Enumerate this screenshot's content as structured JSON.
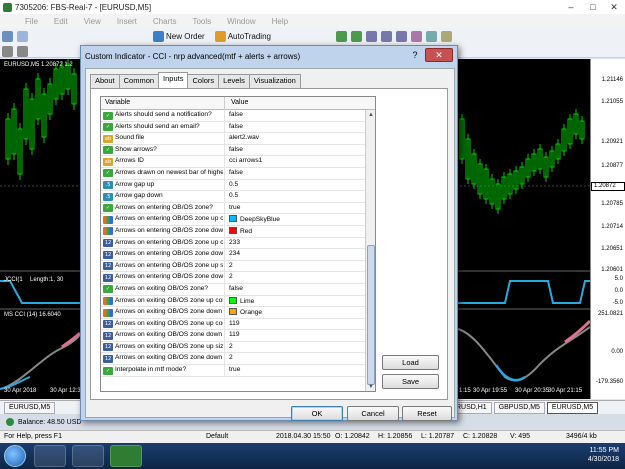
{
  "window": {
    "title": "7305206: FBS-Real-7 - [EURUSD,M5]",
    "minimize": "–",
    "maximize": "□",
    "close": "✕"
  },
  "menu": [
    "File",
    "Edit",
    "View",
    "Insert",
    "Charts",
    "Tools",
    "Window",
    "Help"
  ],
  "toolbar": {
    "new_order": "New Order",
    "autotrading": "AutoTrading"
  },
  "chart": {
    "symbol_label": "EURUSD,M5  1.20872 1.2",
    "cci_label": "JCCI(1",
    "cci_label_rest": "Length:1, 30",
    "mscci_label": "MS CCI (14) 16.6040",
    "price_labels": [
      "1.21146",
      "1.21055",
      "1.20921",
      "1.20877",
      "1.20785",
      "1.20714",
      "1.20651",
      "1.20601",
      "1.20544"
    ],
    "current_price": "1.20872",
    "cci_levels": [
      "5.0",
      "0.0",
      "-5.0"
    ],
    "mscci_levels": [
      "251.0821",
      "0.00",
      "-179.3560"
    ],
    "time_labels_left": [
      "30 Apr 2018",
      "30 Apr 12:35"
    ],
    "time_labels_right": [
      "1:15",
      "30 Apr 19:55",
      "30 Apr 20:35",
      "30 Apr 21:15",
      "30 Apr 21:55"
    ]
  },
  "chart_tabs": [
    "EURUSD,M5",
    "EURUSD,H1",
    "GBPUSD,M5",
    "EURUSD,M5"
  ],
  "balance": "Balance: 48.50 USD",
  "status": {
    "help": "For Help, press F1",
    "profile": "Default",
    "time": "2018.04.30 15:50",
    "open": "O: 1.20842",
    "high": "H: 1.20856",
    "low": "L: 1.20787",
    "close": "C: 1.20828",
    "volume": "V: 495",
    "traffic": "3496/4 kb"
  },
  "tray": {
    "time": "11:55 PM",
    "date": "4/30/2018"
  },
  "dialog": {
    "title": "Custom Indicator - CCI - nrp  advanced(mtf + alerts + arrows)",
    "help": "?",
    "close": "✕",
    "tabs": [
      "About",
      "Common",
      "Inputs",
      "Colors",
      "Levels",
      "Visualization"
    ],
    "active_tab": "Inputs",
    "col_variable": "Variable",
    "col_value": "Value",
    "params": [
      {
        "type": "bool",
        "name": "Alerts should send a notification?",
        "value": "false"
      },
      {
        "type": "bool",
        "name": "Alerts should send an email?",
        "value": "false"
      },
      {
        "type": "str",
        "name": "Sound file",
        "value": "alert2.wav"
      },
      {
        "type": "bool",
        "name": "Show arrows?",
        "value": "false"
      },
      {
        "type": "str",
        "name": "Arrows ID",
        "value": "cci arrows1"
      },
      {
        "type": "bool",
        "name": "Arrows drawn on newest bar of higher...",
        "value": "false"
      },
      {
        "type": "dbl",
        "name": "Arrow gap up",
        "value": "0.5"
      },
      {
        "type": "dbl",
        "name": "Arrow gap down",
        "value": "0.5"
      },
      {
        "type": "bool",
        "name": "Arrows on entering OB/OS zone?",
        "value": "true"
      },
      {
        "type": "clr",
        "name": "Arrows on entering OB/OS zone up c...",
        "value": "DeepSkyBlue",
        "color": "#00bfff"
      },
      {
        "type": "clr",
        "name": "Arrows on entering OB/OS zone down ...",
        "value": "Red",
        "color": "#ff0000"
      },
      {
        "type": "int",
        "name": "Arrows on entering OB/OS zone up c...",
        "value": "233"
      },
      {
        "type": "int",
        "name": "Arrows on entering OB/OS zone down...",
        "value": "234"
      },
      {
        "type": "int",
        "name": "Arrows on entering OB/OS zone up size",
        "value": "2"
      },
      {
        "type": "int",
        "name": "Arrows on entering OB/OS zone down...",
        "value": "2"
      },
      {
        "type": "bool",
        "name": "Arrows on exiting OB/OS zone?",
        "value": "false"
      },
      {
        "type": "clr",
        "name": "Arrows on exiting OB/OS zone up color",
        "value": "Lime",
        "color": "#00ff00"
      },
      {
        "type": "clr",
        "name": "Arrows on exiting OB/OS zone down ...",
        "value": "Orange",
        "color": "#ffa500"
      },
      {
        "type": "int",
        "name": "Arrows on exiting OB/OS zone up code",
        "value": "119"
      },
      {
        "type": "int",
        "name": "Arrows on exiting OB/OS zone down ...",
        "value": "119"
      },
      {
        "type": "int",
        "name": "Arrows on exiting OB/OS zone up size",
        "value": "2"
      },
      {
        "type": "int",
        "name": "Arrows on exiting OB/OS zone down ...",
        "value": "2"
      },
      {
        "type": "bool",
        "name": "Interpolate in mtf mode?",
        "value": "true"
      }
    ],
    "buttons": {
      "load": "Load",
      "save": "Save",
      "ok": "OK",
      "cancel": "Cancel",
      "reset": "Reset"
    }
  },
  "colors": {
    "bull": "#00cc00",
    "cci_line": "#2aa9e0",
    "mscci_line": "#888888",
    "mscci_hot": "#e07090"
  }
}
